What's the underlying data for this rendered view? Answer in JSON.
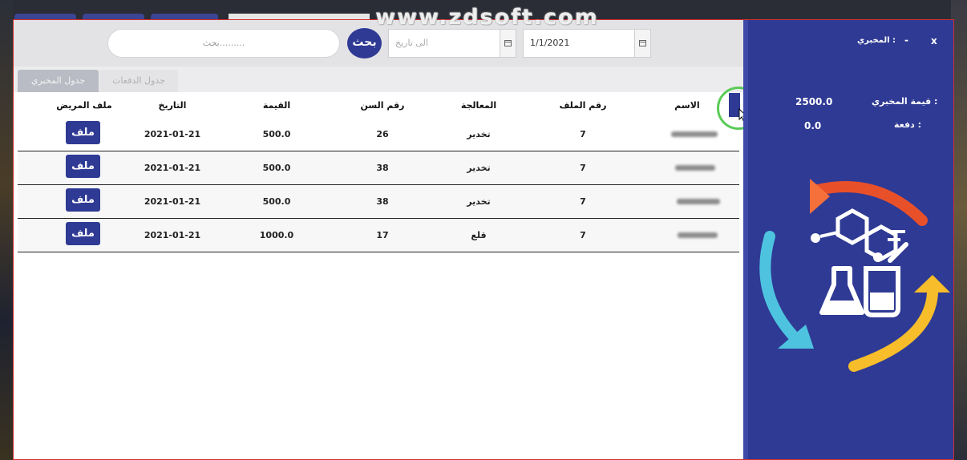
{
  "watermark": "www.zdsoft.com",
  "toolbar": {
    "search_button": "بحث",
    "search_placeholder": "بحث.........",
    "date_to_placeholder": "الى تاريخ",
    "date_from_value": "1/1/2021"
  },
  "tabs": [
    {
      "label": "جدول الدفعات",
      "active": false
    },
    {
      "label": "جدول المخبري",
      "active": true
    }
  ],
  "table": {
    "headers": {
      "name": "الاسم",
      "file_no": "رقم الملف",
      "treatment": "المعالجة",
      "tooth_no": "رقم السن",
      "value": "القيمة",
      "date": "التاريخ",
      "patient_file": "ملف المريض"
    },
    "rows": [
      {
        "file_no": "7",
        "treatment": "تخدير",
        "tooth_no": "26",
        "value": "500.0",
        "date": "2021-01-21",
        "file_button": "ملف"
      },
      {
        "file_no": "7",
        "treatment": "تخدير",
        "tooth_no": "38",
        "value": "500.0",
        "date": "2021-01-21",
        "file_button": "ملف"
      },
      {
        "file_no": "7",
        "treatment": "تخدير",
        "tooth_no": "38",
        "value": "500.0",
        "date": "2021-01-21",
        "file_button": "ملف"
      },
      {
        "file_no": "7",
        "treatment": "قلع",
        "tooth_no": "17",
        "value": "1000.0",
        "date": "2021-01-21",
        "file_button": "ملف"
      }
    ]
  },
  "panel": {
    "close": "x",
    "minimize": "-",
    "lab_title": "المخبري :",
    "lab_value_label": "قيمة المخبري :",
    "lab_value": "2500.0",
    "payment_label": "دفعة :",
    "payment_value": "0.0"
  },
  "colors": {
    "primary": "#2f3a94",
    "arrow_orange": "#e8502a",
    "arrow_yellow": "#f7bd2a",
    "arrow_cyan": "#4ec3e0",
    "cursor_ring": "#5acb57"
  }
}
